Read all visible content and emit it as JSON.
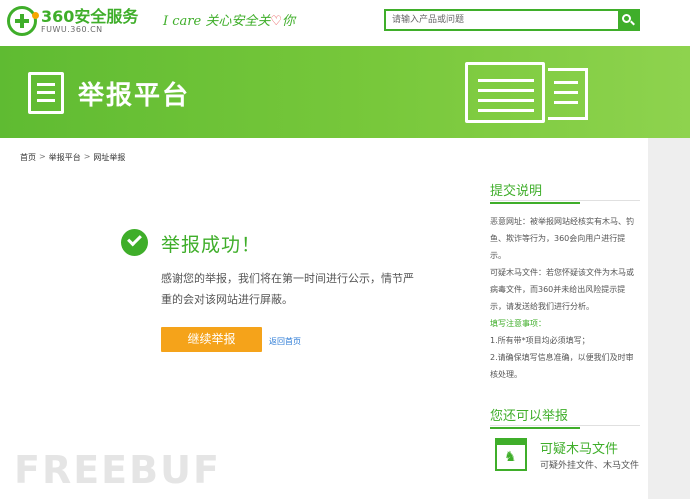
{
  "header": {
    "logo_title": "360安全服务",
    "logo_sub": "FUWU.360.CN",
    "slogan_before": "I care 关心安全关",
    "slogan_heart": "♡",
    "slogan_after": "你",
    "search_placeholder": "请输入产品或问题"
  },
  "banner": {
    "title": "举报平台"
  },
  "breadcrumb": {
    "items": [
      "首页",
      "举报平台",
      "网址举报"
    ],
    "separator": ">"
  },
  "success": {
    "title": "举报成功！",
    "message": "感谢您的举报，我们将在第一时间进行公示，情节严重的会对该网站进行屏蔽。",
    "continue_label": "继续举报",
    "home_link": "返回首页"
  },
  "sidebar": {
    "heading": "提交说明",
    "p1": "恶意网址：被举报网站经核实有木马、钓鱼、欺诈等行为，360会向用户进行提示。",
    "p2": "可疑木马文件：若您怀疑该文件为木马或病毒文件，而360并未给出风险提示提示，请发送给我们进行分析。",
    "p3": "填写注意事项：",
    "p4": "1.所有带*项目均必须填写；",
    "p5": "2.请确保填写信息准确，以便我们及时审核处理。",
    "heading2": "您还可以举报",
    "item_title": "可疑木马文件",
    "item_desc": "可疑外挂文件、木马文件"
  },
  "watermark": "FREEBUF",
  "colors": {
    "brand_green": "#3fae2a",
    "button_orange": "#f5a31a",
    "link_blue": "#2a7ad6"
  }
}
